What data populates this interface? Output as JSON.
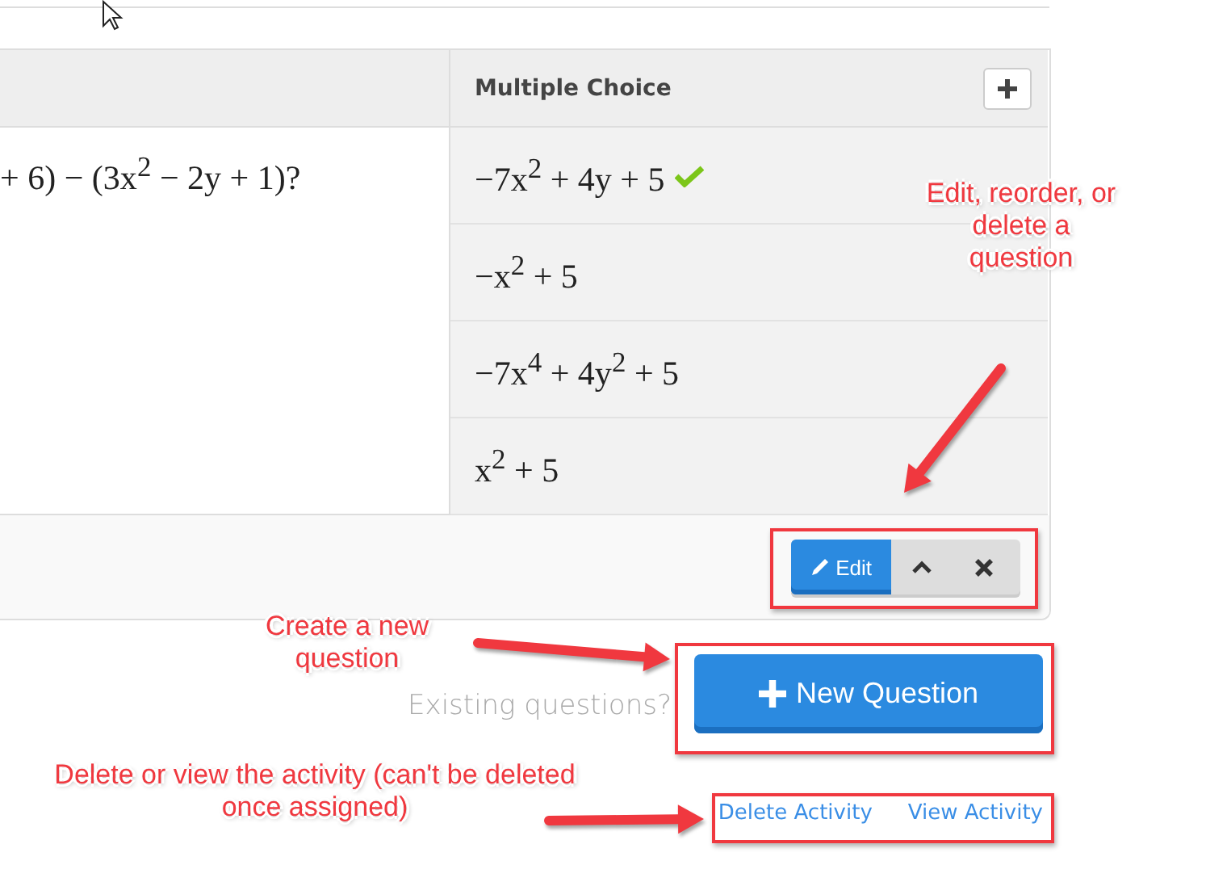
{
  "question": {
    "text": "+ 6) − (3x$^{2}$ − 2y + 1)?"
  },
  "answer_header": "Multiple Choice",
  "answers": [
    {
      "text": "−7x$^{2}$ + 4y + 5",
      "correct": true
    },
    {
      "text": "−x$^{2}$ + 5",
      "correct": false
    },
    {
      "text": "−7x$^{4}$ + 4y$^{2}$ + 5",
      "correct": false
    },
    {
      "text": "x$^{2}$ + 5",
      "correct": false
    }
  ],
  "edit_button": "Edit",
  "existing_prompt": "Existing questions?",
  "new_question_button": "New Question",
  "links": [
    "Delete Activity",
    "View Activity"
  ],
  "annotations": [
    {
      "text": "Edit, reorder, or delete a question"
    },
    {
      "text": "Create a new question"
    },
    {
      "text": "Delete or view the activity (can't be deleted once assigned)"
    }
  ]
}
